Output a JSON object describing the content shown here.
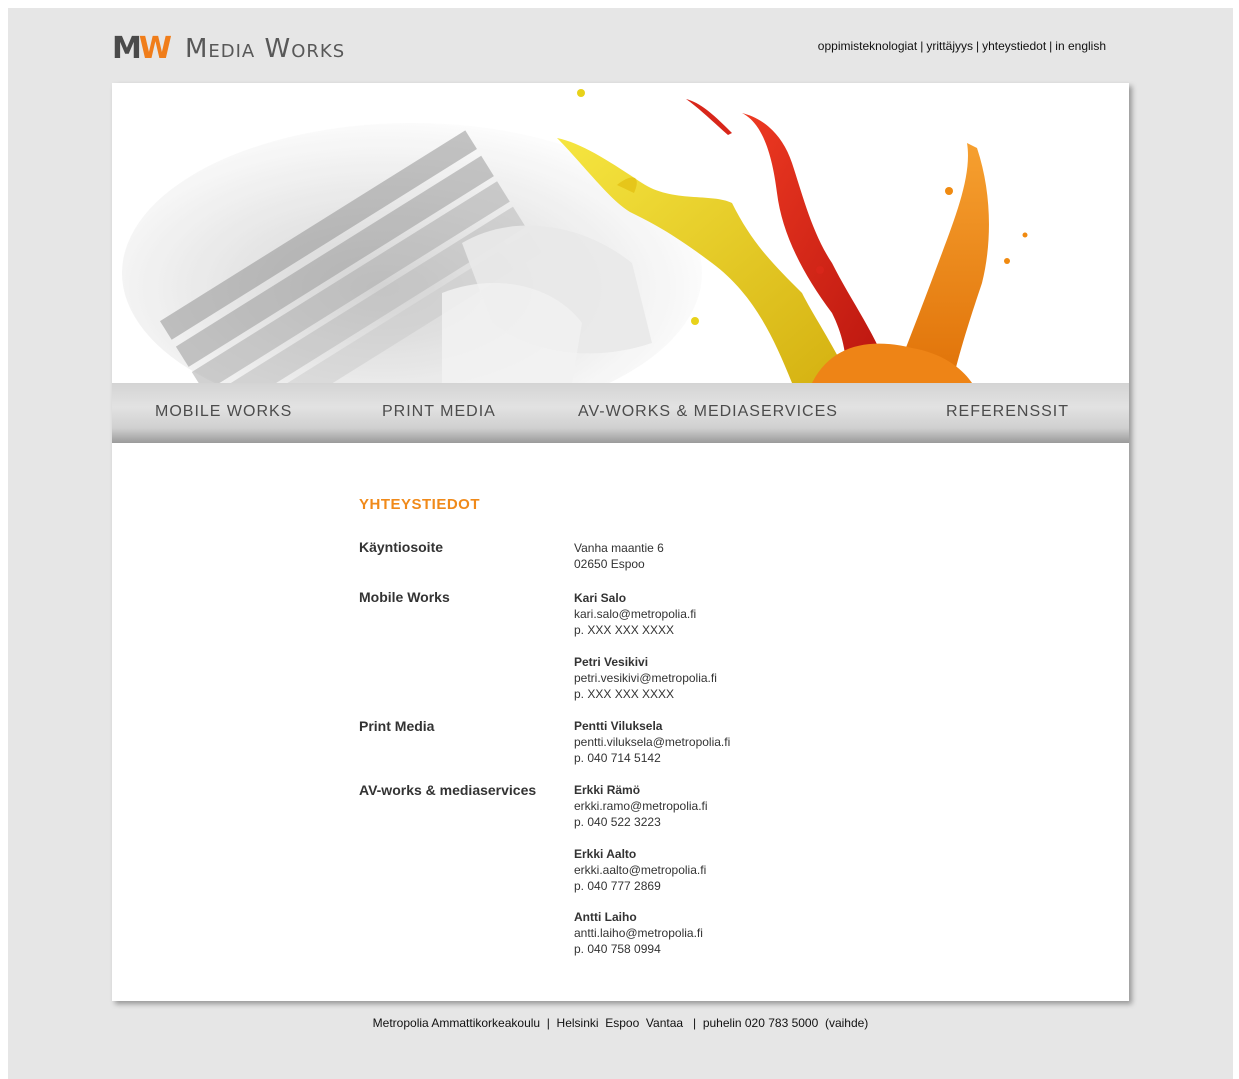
{
  "header": {
    "logo_mark_m": "M",
    "logo_mark_w": "W",
    "logo_text": "Media Works",
    "top_links": [
      "oppimisteknologiat",
      "yrittäjyys",
      "yhteystiedot",
      "in english"
    ],
    "separator": "|"
  },
  "nav": {
    "items": [
      "MOBILE WORKS",
      "PRINT MEDIA",
      "AV-WORKS & MEDIASERVICES",
      "REFERENSSIT"
    ]
  },
  "content": {
    "title": "YHTEYSTIEDOT",
    "address": {
      "label": "Käyntiosoite",
      "line1": "Vanha maantie 6",
      "line2": "02650 Espoo"
    },
    "mobile_works": {
      "label": "Mobile Works",
      "contacts": [
        {
          "name": "Kari Salo",
          "email": "kari.salo@metropolia.fi",
          "phone": "p. XXX XXX XXXX"
        },
        {
          "name": "Petri Vesikivi",
          "email": "petri.vesikivi@metropolia.fi",
          "phone": "p. XXX XXX XXXX"
        }
      ]
    },
    "print_media": {
      "label": "Print Media",
      "contacts": [
        {
          "name": "Pentti Viluksela",
          "email": "pentti.viluksela@metropolia.fi",
          "phone": "p. 040 714 5142"
        }
      ]
    },
    "av_works": {
      "label": "AV-works & mediaservices",
      "contacts": [
        {
          "name": "Erkki Rämö",
          "email": "erkki.ramo@metropolia.fi",
          "phone": "p. 040 522 3223"
        },
        {
          "name": "Erkki Aalto",
          "email": "erkki.aalto@metropolia.fi",
          "phone": "p. 040 777 2869"
        },
        {
          "name": "Antti Laiho",
          "email": "antti.laiho@metropolia.fi",
          "phone": "p. 040 758 0994"
        }
      ]
    }
  },
  "footer": {
    "text": "Metropolia Ammattikorkeakoulu  |  Helsinki  Espoo  Vantaa   |  puhelin 020 783 5000  (vaihde)"
  },
  "colors": {
    "accent": "#f08a1a",
    "background": "#e6e6e6",
    "paint_yellow": "#e8d21a",
    "paint_red": "#d8261a",
    "paint_orange": "#f08a10"
  }
}
